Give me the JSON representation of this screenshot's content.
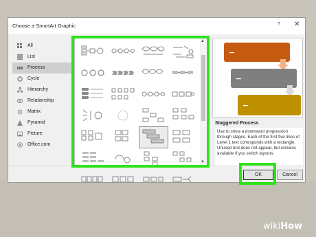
{
  "dialog": {
    "title": "Choose a SmartArt Graphic",
    "help_label": "?",
    "close_label": "✕"
  },
  "categories": [
    {
      "label": "All",
      "icon": "all-icon"
    },
    {
      "label": "List",
      "icon": "list-icon"
    },
    {
      "label": "Process",
      "icon": "process-icon",
      "selected": true
    },
    {
      "label": "Cycle",
      "icon": "cycle-icon"
    },
    {
      "label": "Hierarchy",
      "icon": "hierarchy-icon"
    },
    {
      "label": "Relationship",
      "icon": "relationship-icon"
    },
    {
      "label": "Matrix",
      "icon": "matrix-icon"
    },
    {
      "label": "Pyramid",
      "icon": "pyramid-icon"
    },
    {
      "label": "Picture",
      "icon": "picture-icon"
    },
    {
      "label": "Office.com",
      "icon": "office-icon"
    }
  ],
  "selected_layout": {
    "name": "Staggered Process",
    "description": "Use to show a downward progression through stages. Each of the first five lines of Level 1 text corresponds with a rectangle. Unused text does not appear, but remains available if you switch layouts."
  },
  "preview": {
    "colors": [
      "#c55a11",
      "#7f7f7f",
      "#bf9000"
    ],
    "arrow_color": "#f4b183"
  },
  "buttons": {
    "ok": "OK",
    "cancel": "Cancel"
  },
  "highlight_color": "#2ee31c",
  "watermark": {
    "prefix": "wiki",
    "suffix": "How"
  }
}
